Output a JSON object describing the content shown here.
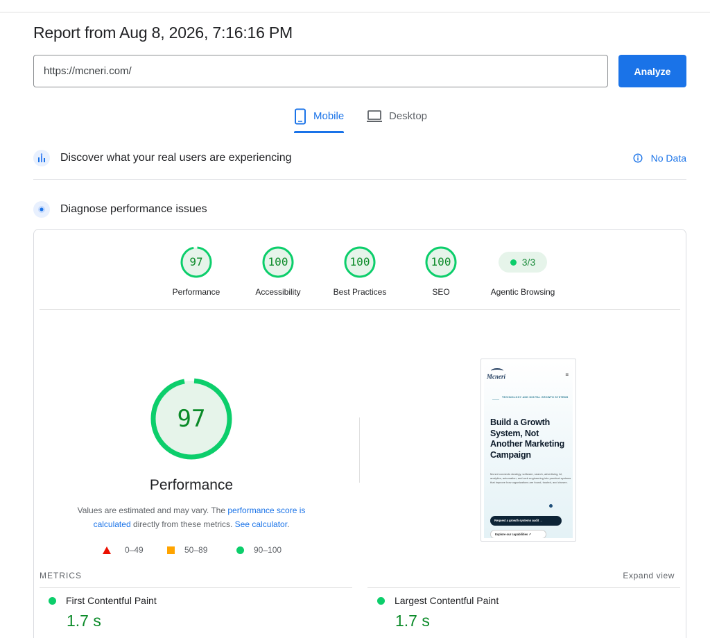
{
  "report": {
    "title": "Report from Aug 8, 2026, 7:16:16 PM"
  },
  "search": {
    "url_value": "https://mcneri.com/",
    "analyze_label": "Analyze"
  },
  "tabs": [
    {
      "label": "Mobile",
      "active": true,
      "icon": "smartphone-icon"
    },
    {
      "label": "Desktop",
      "active": false,
      "icon": "laptop-icon"
    }
  ],
  "field_data": {
    "title": "Discover what your real users are experiencing",
    "status": "No Data",
    "status_icon": "info-icon"
  },
  "lab_data": {
    "title": "Diagnose performance issues"
  },
  "categories": [
    {
      "label": "Performance",
      "score": "97",
      "fraction": 0.97
    },
    {
      "label": "Accessibility",
      "score": "100",
      "fraction": 1.0
    },
    {
      "label": "Best Practices",
      "score": "100",
      "fraction": 1.0
    },
    {
      "label": "SEO",
      "score": "100",
      "fraction": 1.0
    },
    {
      "label": "Agentic Browsing",
      "score": "3/3"
    }
  ],
  "performance": {
    "score": "97",
    "fraction": 0.97,
    "label": "Performance",
    "note_prefix": "Values are estimated and may vary. The ",
    "note_link1": "performance score is calculated",
    "note_mid": " directly from these metrics. ",
    "note_link2": "See calculator",
    "note_suffix": "."
  },
  "legend": [
    {
      "shape": "triangle",
      "color": "#eb0f00",
      "range": "0–49"
    },
    {
      "shape": "square",
      "color": "#ffa400",
      "range": "50–89"
    },
    {
      "shape": "circle",
      "color": "#0cce6b",
      "range": "90–100"
    }
  ],
  "screenshot": {
    "logo": "Mcneri",
    "tag": "TECHNOLOGY AND DIGITAL GROWTH SYSTEMS",
    "headline": "Build a Growth System, Not Another Marketing Campaign",
    "body": "Mcneri connects strategy, software, search, advertising, AI, analytics, automation, and web engineering into practical systems that improve how organizations are found, trusted, and chosen.",
    "primary_cta": "Request a growth systems audit →",
    "secondary_cta": "Explore our capabilities ↗"
  },
  "metrics": {
    "heading": "METRICS",
    "expand_label": "Expand view",
    "items": [
      {
        "name": "First Contentful Paint",
        "value": "1.7 s"
      },
      {
        "name": "Largest Contentful Paint",
        "value": "1.7 s"
      }
    ]
  },
  "colors": {
    "accent": "#1a73e8",
    "pass": "#0cce6b",
    "pass_text": "#0a8a28",
    "average": "#ffa400",
    "fail": "#eb0f00"
  }
}
